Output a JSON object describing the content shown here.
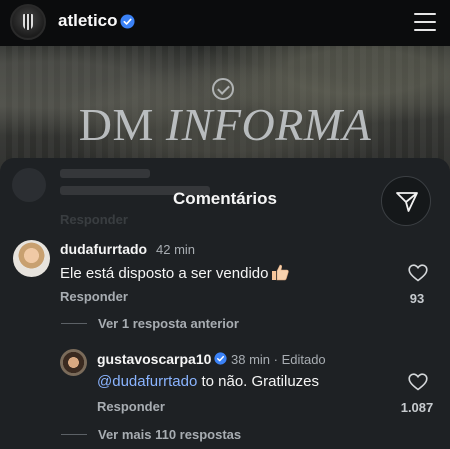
{
  "profile": {
    "username": "atletico"
  },
  "post": {
    "title_part1": "DM ",
    "title_part2": "INFORMA"
  },
  "sheet": {
    "title": "Comentários",
    "ghost_reply": "Responder"
  },
  "comments": [
    {
      "username": "dudafurrtado",
      "time": "42 min",
      "text": "Ele está disposto a ser vendido",
      "reply_label": "Responder",
      "likes": "93",
      "thread_link": "Ver 1 resposta anterior"
    }
  ],
  "reply": {
    "username": "gustavoscarpa10",
    "time": "38 min · Editado",
    "mention": "@dudafurrtado",
    "text": " to não. Gratiluzes",
    "reply_label": "Responder",
    "likes": "1.087"
  },
  "more_link": "Ver mais 110 respostas",
  "colors": {
    "verified": "#3b82f6",
    "mention": "#8ab4ff",
    "sheet_bg": "#1e2124"
  },
  "icons": [
    "verified-badge-icon",
    "hamburger-menu-icon",
    "filter-send-icon",
    "heart-icon",
    "thumbs-up-emoji"
  ]
}
